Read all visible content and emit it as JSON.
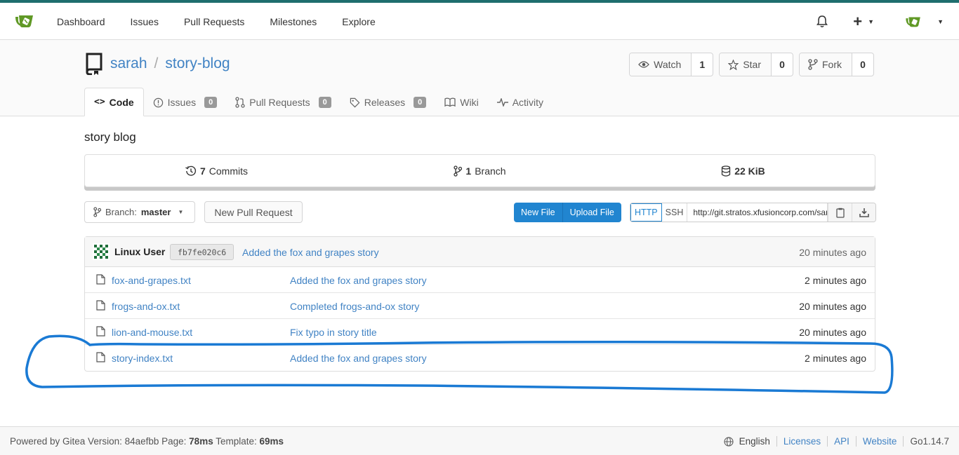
{
  "nav": {
    "items": [
      "Dashboard",
      "Issues",
      "Pull Requests",
      "Milestones",
      "Explore"
    ],
    "plus_symbol": "+"
  },
  "repo": {
    "owner": "sarah",
    "separator": "/",
    "name": "story-blog",
    "watch": {
      "label": "Watch",
      "count": "1"
    },
    "star": {
      "label": "Star",
      "count": "0"
    },
    "fork": {
      "label": "Fork",
      "count": "0"
    }
  },
  "tabs": [
    {
      "label": "Code"
    },
    {
      "label": "Issues",
      "badge": "0"
    },
    {
      "label": "Pull Requests",
      "badge": "0"
    },
    {
      "label": "Releases",
      "badge": "0"
    },
    {
      "label": "Wiki"
    },
    {
      "label": "Activity"
    }
  ],
  "description": "story blog",
  "stats": {
    "commits_count": "7",
    "commits_label": "Commits",
    "branch_count": "1",
    "branch_label": "Branch",
    "size": "22 KiB"
  },
  "toolbar": {
    "branch_prefix": "Branch:",
    "branch_name": "master",
    "new_pull_request": "New Pull Request",
    "new_file": "New File",
    "upload_file": "Upload File",
    "http": "HTTP",
    "ssh": "SSH",
    "clone_url": "http://git.stratos.xfusioncorp.com/sarah/story-blog.git"
  },
  "latest_commit": {
    "author": "Linux User",
    "sha": "fb7fe020c6",
    "message": "Added the fox and grapes story",
    "time": "20 minutes ago"
  },
  "files": [
    {
      "name": "fox-and-grapes.txt",
      "message": "Added the fox and grapes story",
      "time": "2 minutes ago"
    },
    {
      "name": "frogs-and-ox.txt",
      "message": "Completed frogs-and-ox story",
      "time": "20 minutes ago"
    },
    {
      "name": "lion-and-mouse.txt",
      "message": "Fix typo in story title",
      "time": "20 minutes ago"
    },
    {
      "name": "story-index.txt",
      "message": "Added the fox and grapes story",
      "time": "2 minutes ago"
    }
  ],
  "footer": {
    "powered_prefix": "Powered by Gitea Version: 84aefbb Page: ",
    "page_time": "78ms",
    "template_prefix": " Template: ",
    "template_time": "69ms",
    "language": "English",
    "licenses": "Licenses",
    "api": "API",
    "website": "Website",
    "go_version": "Go1.14.7"
  },
  "colors": {
    "accent": "#2185d0",
    "link": "#4183c4",
    "annotation": "#1a7ad4",
    "topbar": "#1f6e6e",
    "gitea_green": "#609926"
  }
}
